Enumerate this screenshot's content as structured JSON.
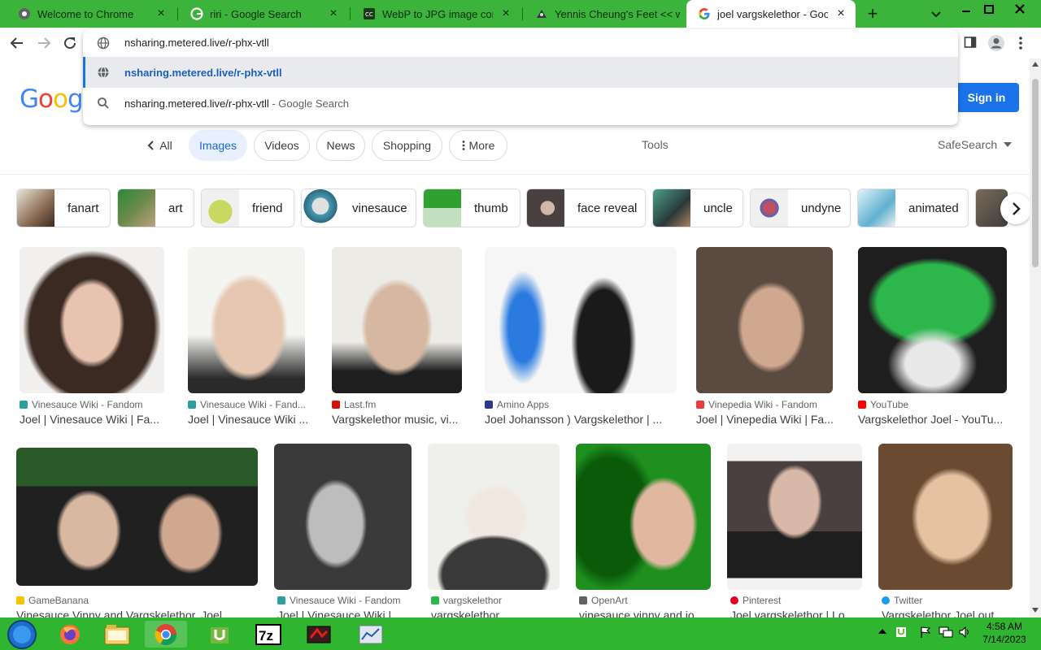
{
  "browser": {
    "tabs": [
      {
        "title": "Welcome to Chrome",
        "favicon": "chrome-icon",
        "active": false
      },
      {
        "title": "riri - Google Search",
        "favicon": "google-icon",
        "active": false
      },
      {
        "title": "WebP to JPG image conve",
        "favicon": "converter-icon",
        "active": false
      },
      {
        "title": "Yennis Cheung's Feet << w",
        "favicon": "feet-icon",
        "active": false
      },
      {
        "title": "joel vargskelethor - Google",
        "favicon": "google-icon",
        "active": true
      }
    ],
    "omnibox": {
      "value": "nsharing.metered.live/r-phx-vtll",
      "suggestions": [
        {
          "text": "nsharing.metered.live/r-phx-vtll",
          "suffix": "",
          "icon": "globe-icon"
        },
        {
          "text": "nsharing.metered.live/r-phx-vtll",
          "suffix": " - Google Search",
          "icon": "search-icon"
        }
      ]
    }
  },
  "page": {
    "logo": "Google",
    "sign_in": "Sign in",
    "filters": {
      "all": "All",
      "images": "Images",
      "videos": "Videos",
      "news": "News",
      "shopping": "Shopping",
      "more": "More"
    },
    "tools": "Tools",
    "safesearch": "SafeSearch",
    "related": [
      {
        "label": "fanart",
        "color": "#8a6a52"
      },
      {
        "label": "art",
        "color": "#6b8a4a"
      },
      {
        "label": "friend",
        "color": "#c8d860"
      },
      {
        "label": "vinesauce",
        "color": "#4a9ab0"
      },
      {
        "label": "thumb",
        "color": "#30a030"
      },
      {
        "label": "face reveal",
        "color": "#4a4040"
      },
      {
        "label": "uncle",
        "color": "#4aa088"
      },
      {
        "label": "undyne",
        "color": "#c05060"
      },
      {
        "label": "animated",
        "color": "#60b0d0"
      }
    ],
    "results": [
      {
        "source": "Vinesauce Wiki - Fandom",
        "title": "Joel | Vinesauce Wiki | Fa...",
        "color": "#e8e4e0"
      },
      {
        "source": "Vinesauce Wiki - Fand...",
        "title": "Joel | Vinesauce Wiki ...",
        "color": "#6a6664"
      },
      {
        "source": "Last.fm",
        "title": "Vargskelethor music, vi...",
        "color": "#d8d4cc"
      },
      {
        "source": "Amino Apps",
        "title": "Joel Johansson ) Vargskelethor | ...",
        "color": "#f4f4f4"
      },
      {
        "source": "Vinepedia Wiki - Fandom",
        "title": "Joel | Vinepedia Wiki | Fa...",
        "color": "#5a4a40"
      },
      {
        "source": "YouTube",
        "title": "Vargskelethor Joel - YouTu...",
        "color": "#222222"
      },
      {
        "source": "GameBanana",
        "title": "Vinesauce Vinny and Vargskelethor, Joel",
        "color": "#202020"
      },
      {
        "source": "Vinesauce Wiki - Fandom",
        "title": "Joel | Vinesauce Wiki |",
        "color": "#3a3a3a"
      },
      {
        "source": "vargskelethor",
        "title": "vargskelethor",
        "color": "#efefeb"
      },
      {
        "source": "OpenArt",
        "title": "vinesauce vinny and jo...",
        "color": "#1f8f1f"
      },
      {
        "source": "Pinterest",
        "title": "Joel vargskelethor | Lo...",
        "color": "#f2f2f2"
      },
      {
        "source": "Twitter",
        "title": "Vargskelethor Joel out",
        "color": "#6a4a30"
      }
    ]
  },
  "taskbar": {
    "apps": [
      "start-orb",
      "firefox-icon",
      "file-explorer-icon",
      "chrome-icon",
      "utorrent-icon",
      "7zip-icon",
      "media-app-icon",
      "network-monitor-icon"
    ],
    "time": "4:58 AM",
    "date": "7/14/2023"
  },
  "colors": {
    "tabstrip": "#3cb43c",
    "taskbar": "#2fb52f",
    "accent": "#1a73e8"
  }
}
